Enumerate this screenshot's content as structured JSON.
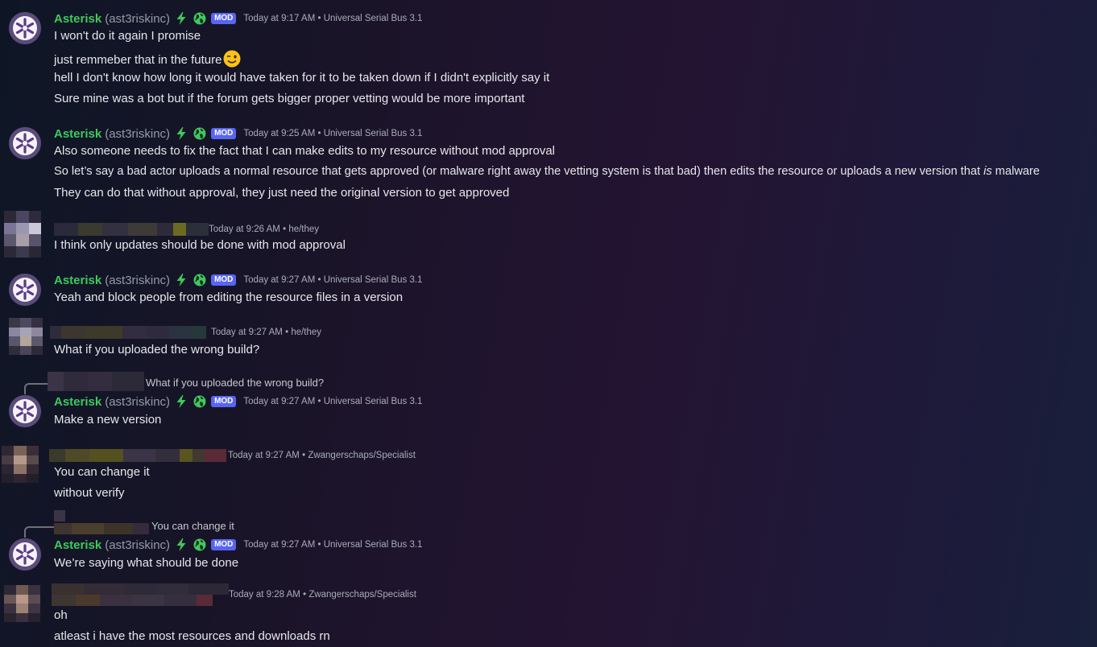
{
  "asterisk": {
    "name": "Asterisk",
    "handle": "(ast3riskinc)",
    "badge": "MOD",
    "color": "#3ec95c"
  },
  "messages": [
    {
      "ts": "Today at 9:17 AM",
      "tag": "Universal Serial Bus 3.1",
      "lines": [
        "I won't do it again I promise",
        "just remmeber that in the future",
        "hell I don't know how long it would have taken for it to be taken down if I didn't explicitly say it",
        "Sure mine was a bot but if the forum gets bigger proper vetting would be more important"
      ]
    },
    {
      "ts": "Today at 9:25 AM",
      "tag": "Universal Serial Bus 3.1",
      "lines": [
        "Also someone needs to fix the fact that I can make edits to my resource  without mod approval",
        "So let’s say a bad actor uploads a normal resource that gets approved (or malware right away the vetting system is that bad) then edits the resource or uploads a new version that ",
        "is",
        " malware",
        "They can do that without approval, they just need the original version to get approved"
      ]
    },
    {
      "ts": "Today at 9:26 AM",
      "tag": "he/they",
      "lines": [
        "I think only updates should be done with mod approval"
      ]
    },
    {
      "ts": "Today at 9:27 AM",
      "tag": "Universal Serial Bus 3.1",
      "lines": [
        "Yeah and block people from editing the resource files in a version"
      ]
    },
    {
      "ts": "Today at 9:27 AM",
      "tag": "he/they",
      "lines": [
        "What if you uploaded the wrong build?"
      ]
    },
    {
      "reply": "What if you uploaded the wrong build?",
      "ts": "Today at 9:27 AM",
      "tag": "Universal Serial Bus 3.1",
      "lines": [
        "Make a new version"
      ]
    },
    {
      "ts": "Today at 9:27 AM",
      "tag": "Zwangerschaps/Specialist",
      "lines": [
        "You can change it",
        "without verify"
      ]
    },
    {
      "reply": "You can change it",
      "ts": "Today at 9:27 AM",
      "tag": "Universal Serial Bus 3.1",
      "lines": [
        "We’re saying what should be done"
      ]
    },
    {
      "ts": "Today at 9:28 AM",
      "tag": "Zwangerschaps/Specialist",
      "lines": [
        "oh",
        "atleast i have the most resources and downloads rn"
      ]
    }
  ],
  "sep": "•"
}
